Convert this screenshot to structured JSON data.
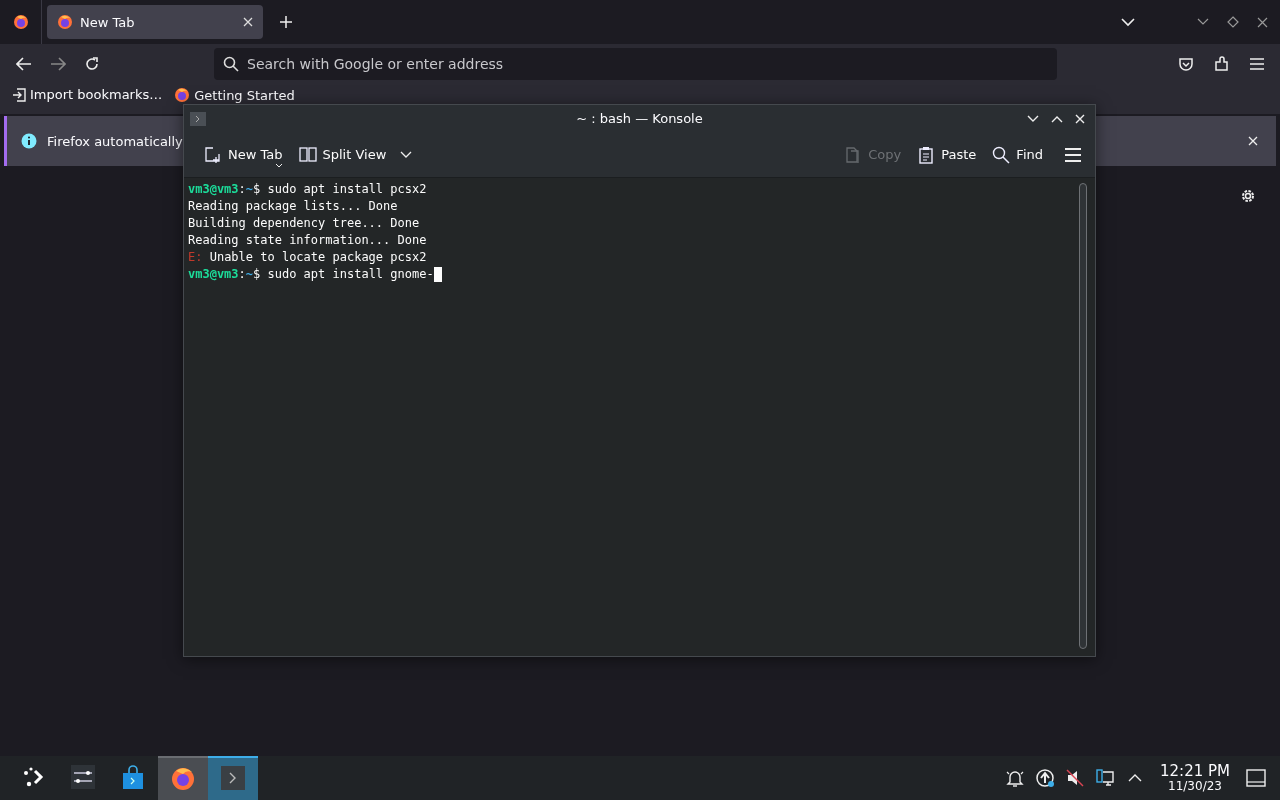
{
  "browser": {
    "tabs": [
      {
        "label": "New Tab",
        "selected": true
      }
    ],
    "address_bar": {
      "placeholder": "Search with Google or enter address"
    },
    "bookmarks": [
      {
        "label": "Import bookmarks…",
        "kind": "import"
      },
      {
        "label": "Getting Started",
        "kind": "firefox"
      }
    ],
    "notification": {
      "text": "Firefox automatically"
    }
  },
  "konsole": {
    "title": "~ : bash — Konsole",
    "toolbar": [
      {
        "label": "New Tab",
        "kind": "newtab",
        "disabled": false
      },
      {
        "label": "Split View",
        "kind": "split",
        "disabled": false
      },
      {
        "label": "Copy",
        "kind": "copy",
        "disabled": true
      },
      {
        "label": "Paste",
        "kind": "paste",
        "disabled": false
      },
      {
        "label": "Find",
        "kind": "find",
        "disabled": false
      }
    ],
    "lines": [
      {
        "kind": "prompt",
        "user": "vm3@vm3",
        "sep": ":",
        "path": "~",
        "sign": "$",
        "command": " sudo apt install pcsx2",
        "cursor": false
      },
      {
        "kind": "output",
        "text": "Reading package lists... Done"
      },
      {
        "kind": "output",
        "text": "Building dependency tree... Done"
      },
      {
        "kind": "output",
        "text": "Reading state information... Done"
      },
      {
        "kind": "error",
        "tag": "E:",
        "text": " Unable to locate package pcsx2"
      },
      {
        "kind": "prompt",
        "user": "vm3@vm3",
        "sep": ":",
        "path": "~",
        "sign": "$",
        "command": " sudo apt install gnome-",
        "cursor": true
      }
    ]
  },
  "taskbar": {
    "apps": [
      {
        "kind": "launcher",
        "selected": false
      },
      {
        "kind": "settings",
        "selected": false
      },
      {
        "kind": "store",
        "selected": false
      },
      {
        "kind": "firefox",
        "selected": true
      },
      {
        "kind": "terminal",
        "selected": true
      }
    ],
    "tray": [
      {
        "kind": "bell"
      },
      {
        "kind": "update"
      },
      {
        "kind": "mute"
      },
      {
        "kind": "network"
      },
      {
        "kind": "arrow"
      }
    ],
    "time": "12:21 PM",
    "date": "11/30/23"
  }
}
